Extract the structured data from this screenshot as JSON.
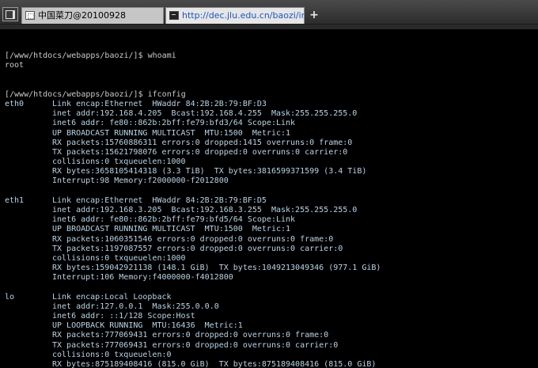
{
  "tabbar": {
    "tabs": [
      {
        "label": "中国菜刀@20100928",
        "icon": "app-window-icon",
        "active": false
      },
      {
        "label": "http://dec.jlu.edu.cn/baozi/in...",
        "icon": "terminal-icon",
        "active": true
      }
    ],
    "new_tab_label": "+"
  },
  "terminal": {
    "lines": [
      {
        "kind": "prompt",
        "text": "[/www/htdocs/webapps/baozi/]$ whoami"
      },
      {
        "kind": "out",
        "text": "root"
      },
      {
        "kind": "blank",
        "text": ""
      },
      {
        "kind": "blank",
        "text": ""
      },
      {
        "kind": "prompt",
        "text": "[/www/htdocs/webapps/baozi/]$ ifconfig"
      },
      {
        "kind": "iface",
        "iface": "eth0",
        "text": "Link encap:Ethernet  HWaddr 84:2B:2B:79:BF:D3"
      },
      {
        "kind": "iface",
        "iface": "",
        "text": "inet addr:192.168.4.205  Bcast:192.168.4.255  Mask:255.255.255.0"
      },
      {
        "kind": "iface",
        "iface": "",
        "text": "inet6 addr: fe80::862b:2bff:fe79:bfd3/64 Scope:Link"
      },
      {
        "kind": "iface",
        "iface": "",
        "text": "UP BROADCAST RUNNING MULTICAST  MTU:1500  Metric:1"
      },
      {
        "kind": "iface",
        "iface": "",
        "text": "RX packets:15760886311 errors:0 dropped:1415 overruns:0 frame:0"
      },
      {
        "kind": "iface",
        "iface": "",
        "text": "TX packets:15621798076 errors:0 dropped:0 overruns:0 carrier:0"
      },
      {
        "kind": "iface",
        "iface": "",
        "text": "collisions:0 txqueuelen:1000"
      },
      {
        "kind": "iface",
        "iface": "",
        "text": "RX bytes:3658105414318 (3.3 TiB)  TX bytes:3816599371599 (3.4 TiB)"
      },
      {
        "kind": "iface",
        "iface": "",
        "text": "Interrupt:98 Memory:f2000000-f2012800"
      },
      {
        "kind": "blank",
        "text": ""
      },
      {
        "kind": "iface",
        "iface": "eth1",
        "text": "Link encap:Ethernet  HWaddr 84:2B:2B:79:BF:D5"
      },
      {
        "kind": "iface",
        "iface": "",
        "text": "inet addr:192.168.3.205  Bcast:192.168.3.255  Mask:255.255.255.0"
      },
      {
        "kind": "iface",
        "iface": "",
        "text": "inet6 addr: fe80::862b:2bff:fe79:bfd5/64 Scope:Link"
      },
      {
        "kind": "iface",
        "iface": "",
        "text": "UP BROADCAST RUNNING MULTICAST  MTU:1500  Metric:1"
      },
      {
        "kind": "iface",
        "iface": "",
        "text": "RX packets:1060351546 errors:0 dropped:0 overruns:0 frame:0"
      },
      {
        "kind": "iface",
        "iface": "",
        "text": "TX packets:1197087557 errors:0 dropped:0 overruns:0 carrier:0"
      },
      {
        "kind": "iface",
        "iface": "",
        "text": "collisions:0 txqueuelen:1000"
      },
      {
        "kind": "iface",
        "iface": "",
        "text": "RX bytes:159042921138 (148.1 GiB)  TX bytes:1049213049346 (977.1 GiB)"
      },
      {
        "kind": "iface",
        "iface": "",
        "text": "Interrupt:106 Memory:f4000000-f4012800"
      },
      {
        "kind": "blank",
        "text": ""
      },
      {
        "kind": "iface",
        "iface": "lo",
        "text": "Link encap:Local Loopback"
      },
      {
        "kind": "iface",
        "iface": "",
        "text": "inet addr:127.0.0.1  Mask:255.0.0.0"
      },
      {
        "kind": "iface",
        "iface": "",
        "text": "inet6 addr: ::1/128 Scope:Host"
      },
      {
        "kind": "iface",
        "iface": "",
        "text": "UP LOOPBACK RUNNING  MTU:16436  Metric:1"
      },
      {
        "kind": "iface",
        "iface": "",
        "text": "RX packets:777069431 errors:0 dropped:0 overruns:0 frame:0"
      },
      {
        "kind": "iface",
        "iface": "",
        "text": "TX packets:777069431 errors:0 dropped:0 overruns:0 carrier:0"
      },
      {
        "kind": "iface",
        "iface": "",
        "text": "collisions:0 txqueuelen:0"
      },
      {
        "kind": "iface",
        "iface": "",
        "text": "RX bytes:875189408416 (815.0 GiB)  TX bytes:875189408416 (815.0 GiB)"
      }
    ]
  },
  "colors": {
    "terminal_bg": "#000000",
    "terminal_text": "#c8c8c8",
    "ifconfig_text": "#b6d4e6",
    "active_tab_text": "#1a55c5",
    "tabbar_bg": "#3a3a3a"
  }
}
